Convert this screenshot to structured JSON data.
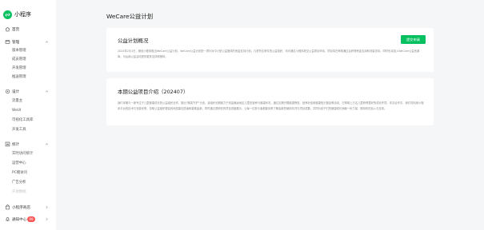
{
  "brand": {
    "name": "小程序",
    "logo_color": "#07c160"
  },
  "sidebar": {
    "home": "首页",
    "management": {
      "label": "管理",
      "items": [
        "版本管理",
        "成员管理",
        "开发管理",
        "推送管理"
      ]
    },
    "design": {
      "label": "设计",
      "items": [
        "流量主",
        "WeUI",
        "可视化工具库",
        "开发工具"
      ]
    },
    "stats": {
      "label": "统计",
      "items": [
        "实时访问统计",
        "运营中心",
        "PC端访问",
        "广告分析",
        "开放数据"
      ]
    },
    "mini_store": "小程序商店",
    "notifications": {
      "label": "通知中心",
      "badge": "99"
    }
  },
  "main": {
    "title": "WeCare公益计划",
    "overview": {
      "title": "公益计划概况",
      "button": "提交申请",
      "body": "2024年2月1日，微信小程序推出WeCare公益计划，WeCare公益计划是一项针对中小型公益团体的资金支持计划。凡是符合条件的公益组织，均可通过小程序提交公益项目申请，项目将在审核通过后获得资金支持和流量扶持，同时也将加入WeCare公益资源库，为后续公益活动提供更多支持和便利。"
    },
    "project": {
      "title": "本期公益项目介绍（202407）",
      "body": "我们本期与一家专注于儿童健康成长的公益组织合作，推出“微笑守护”计划。该组织长期致力于改善偏远地区儿童的营养与健康状况，通过定期开展健康筛查、营养补给和健康知识普及等活动，已帮助上万名儿童获得更好的成长环境。本次合作中，我们将利用小程序平台的技术与流量优势，协助公益组织更高效地招募志愿者和募集善款，同时通过透明化的项目进度展示，让每一位参与者都能清晰了解善款的使用情况与项目成果，共同为孩子们的健康成长贡献一份力量，期待你的加入与支持。"
    }
  }
}
